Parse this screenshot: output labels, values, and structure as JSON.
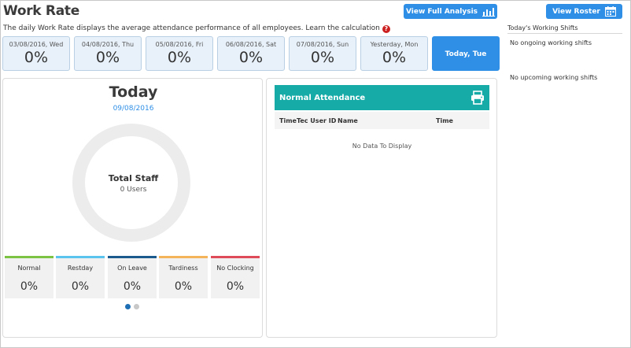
{
  "page": {
    "title": "Work Rate",
    "subtitle": "The daily Work Rate displays the average attendance performance of all employees. Learn the calculation"
  },
  "buttons": {
    "full_analysis": "View Full Analysis",
    "roster": "View Roster"
  },
  "day_cards": [
    {
      "label": "03/08/2016, Wed",
      "value": "0%"
    },
    {
      "label": "04/08/2016, Thu",
      "value": "0%"
    },
    {
      "label": "05/08/2016, Fri",
      "value": "0%"
    },
    {
      "label": "06/08/2016, Sat",
      "value": "0%"
    },
    {
      "label": "07/08/2016, Sun",
      "value": "0%"
    },
    {
      "label": "Yesterday, Mon",
      "value": "0%"
    },
    {
      "label": "Today, Tue",
      "value": ""
    }
  ],
  "today": {
    "heading": "Today",
    "date": "09/08/2016",
    "total_staff_label": "Total Staff",
    "total_staff_value": "0 Users"
  },
  "stats": [
    {
      "label": "Normal",
      "value": "0%",
      "color": "#7cc243"
    },
    {
      "label": "Restday",
      "value": "0%",
      "color": "#5bc4ee"
    },
    {
      "label": "On Leave",
      "value": "0%",
      "color": "#1b5a8c"
    },
    {
      "label": "Tardiness",
      "value": "0%",
      "color": "#f4b55a"
    },
    {
      "label": "No Clocking",
      "value": "0%",
      "color": "#e04b5a"
    }
  ],
  "pager": {
    "active_color": "#1f6fb5",
    "inactive_color": "#c8c8c8"
  },
  "normal_attendance": {
    "title": "Normal Attendance",
    "columns": [
      "TimeTec User ID",
      "Name",
      "Time"
    ],
    "empty_text": "No Data To Display"
  },
  "working_shifts": {
    "title": "Today's Working Shifts",
    "ongoing": "No ongoing working shifts",
    "upcoming": "No upcoming working shifts"
  }
}
